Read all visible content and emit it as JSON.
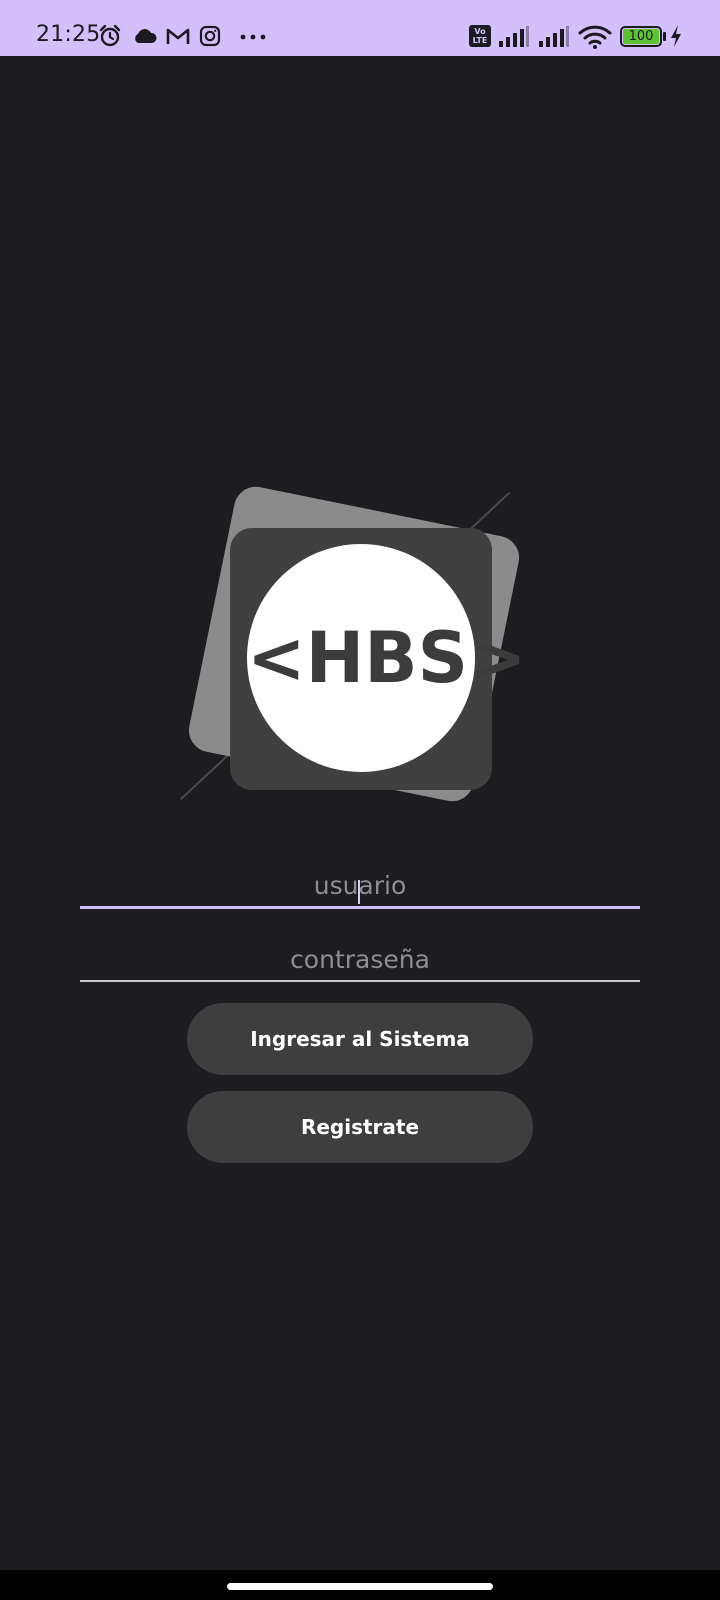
{
  "status_bar": {
    "time": "21:25",
    "left_icons": [
      "alarm-icon",
      "cloud-icon",
      "gmail-icon",
      "instagram-icon",
      "more-dots-icon"
    ],
    "volte_label_top": "Vo",
    "volte_label_bottom": "LTE",
    "battery_level": "100",
    "battery_color": "#5ec234",
    "right_icons": [
      "volte-icon",
      "signal-1-icon",
      "signal-2-icon",
      "wifi-icon",
      "battery-icon",
      "charging-icon"
    ]
  },
  "logo": {
    "text": "<HBS>"
  },
  "login_form": {
    "username_placeholder": "usuario",
    "password_placeholder": "contraseña",
    "login_button": "Ingresar al Sistema",
    "register_button": "Registrate"
  },
  "colors": {
    "background": "#1d1c20",
    "status_bar": "#d3c0fb",
    "focused_underline": "#cbbdf3",
    "button": "#3e3e3e"
  }
}
